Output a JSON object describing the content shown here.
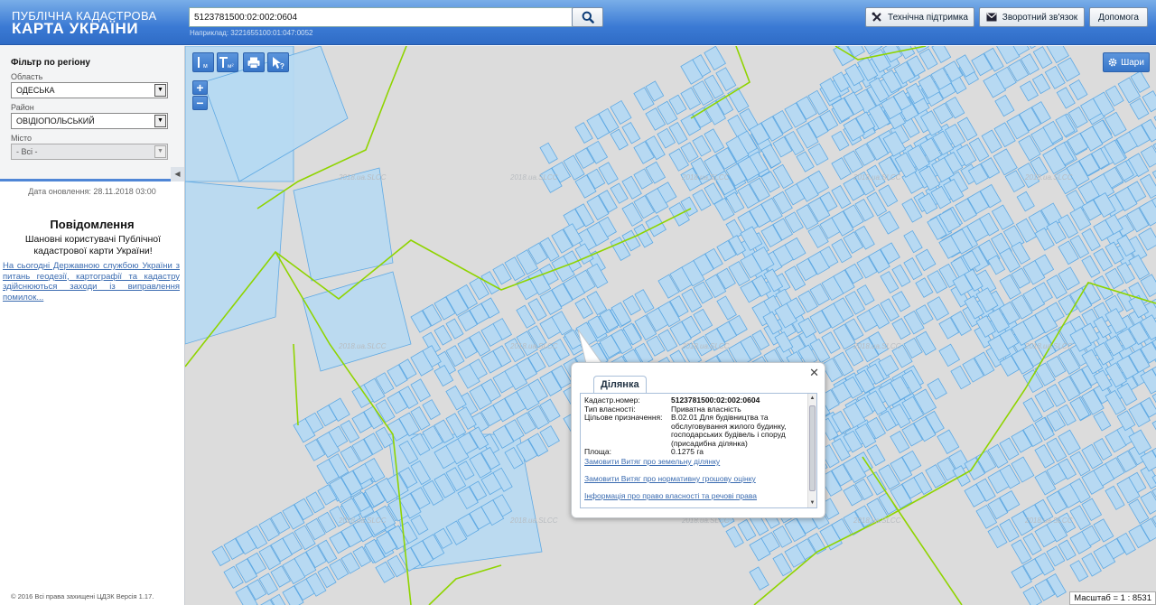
{
  "header": {
    "logo_line1": "ПУБЛІЧНА КАДАСТРОВА",
    "logo_line2": "КАРТА УКРАЇНИ",
    "search_value": "5123781500:02:002:0604",
    "search_hint": "Наприклад: 3221655100:01:047:0052",
    "buttons": {
      "support": "Технічна підтримка",
      "feedback": "Зворотний зв'язок",
      "help": "Допомога"
    }
  },
  "sidebar": {
    "filter_title": "Фільтр по регіону",
    "region_label": "Область",
    "region_value": "ОДЕСЬКА",
    "district_label": "Район",
    "district_value": "ОВІДІОПОЛЬСЬКИЙ",
    "city_label": "Місто",
    "city_value": "- Всі -",
    "update_date": "Дата оновлення: 28.11.2018 03:00",
    "notice_title": "Повідомлення",
    "notice_text": "Шановні користувачі Публічної кадастрової карти України!",
    "notice_link": "На сьогодні Державною службою України з питань геодезії, картографії та кадастру здійснюються заходи із виправлення помилок...",
    "copyright": "© 2016 Всі права захищені ЦДЗК  Версія 1.17."
  },
  "map": {
    "tool_labels": {
      "measure_length": "м",
      "measure_area": "м²"
    },
    "layers_label": "Шари",
    "watermark": "2018.ua.SLCC",
    "scale": "Масштаб = 1 : 8531",
    "colors": {
      "background": "#dcdcdc",
      "parcel_fill": "#b7d9f2",
      "parcel_stroke": "#5fa9e3",
      "boundary": "#8fd400"
    }
  },
  "popup": {
    "tab": "Ділянка",
    "rows": [
      {
        "key": "Кадастр.номер:",
        "value": "5123781500:02:002:0604",
        "bold": true
      },
      {
        "key": "Тип власності:",
        "value": "Приватна власність"
      },
      {
        "key": "Цільове призначення:",
        "value": "В.02.01 Для будівництва та обслуговування жилого будинку, господарських будівель і споруд (присадибна ділянка)"
      },
      {
        "key": "Площа:",
        "value": "0.1275 га"
      }
    ],
    "links": [
      "Замовити Витяг про земельну ділянку",
      "Замовити Витяг про нормативну грошову оцінку",
      "Інформація про право власності та речові права"
    ]
  }
}
